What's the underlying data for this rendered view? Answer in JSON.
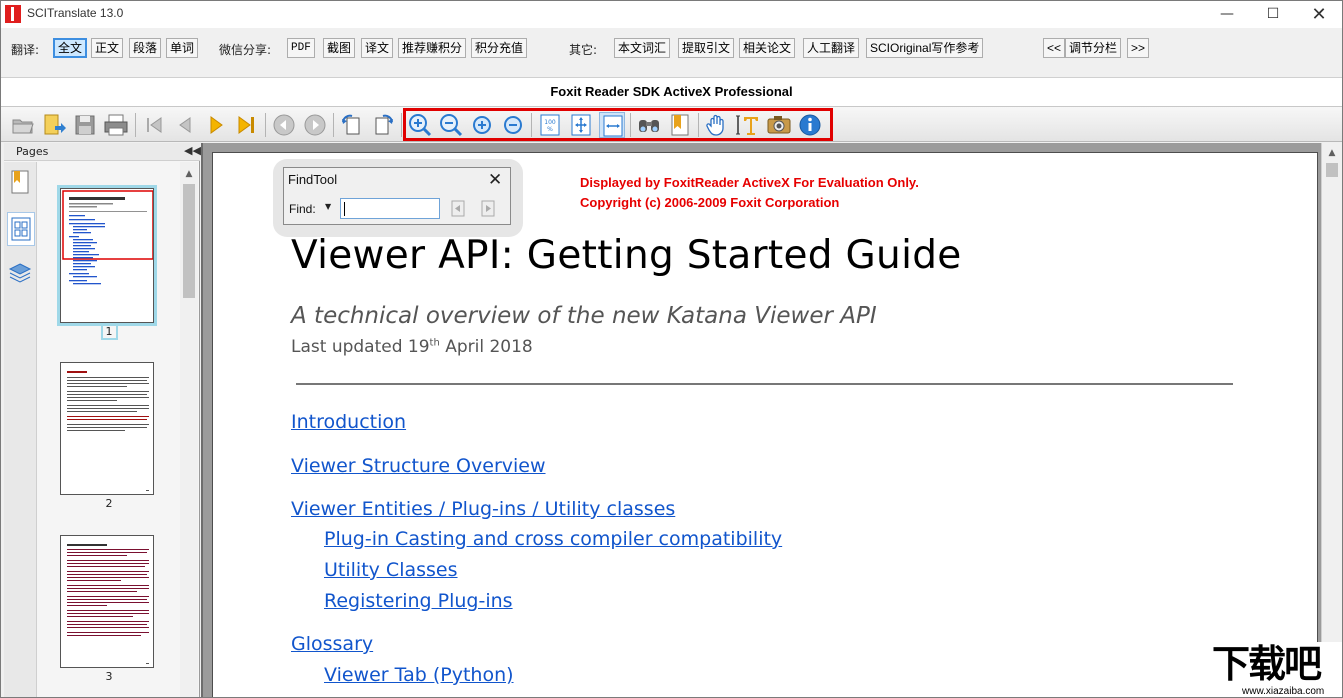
{
  "app": {
    "title": "SCITranslate 13.0"
  },
  "window": {
    "minimize": "—",
    "maximize": "☐",
    "close": "✕"
  },
  "cmdbar": {
    "translate_label": "翻译:",
    "translate_buttons": [
      "全文",
      "正文",
      "段落",
      "单词"
    ],
    "wechat_label": "微信分享:",
    "wechat_buttons": [
      "PDF",
      "截图",
      "译文",
      "推荐赚积分",
      "积分充值"
    ],
    "other_label": "其它:",
    "other_buttons": [
      "本文词汇",
      "提取引文",
      "相关论文",
      "人工翻译",
      "SCIOriginal写作参考"
    ],
    "split_prev": "<<",
    "split_label": "调节分栏",
    "split_next": ">>"
  },
  "viewer": {
    "title": "Foxit Reader SDK ActiveX Professional",
    "toolbar_icons": [
      "open-icon",
      "open-folder-icon",
      "save-icon",
      "print-icon",
      "first-page-icon",
      "prev-page-icon",
      "next-page-icon",
      "last-page-icon",
      "back-icon",
      "forward-icon",
      "rotate-left-icon",
      "rotate-right-icon",
      "zoom-in-icon",
      "zoom-out-icon",
      "zoom-plus-icon",
      "zoom-minus-icon",
      "actual-size-icon",
      "fit-page-icon",
      "fit-width-icon",
      "find-icon",
      "bookmark-icon",
      "hand-tool-icon",
      "text-select-icon",
      "snapshot-icon",
      "info-icon"
    ],
    "highlight_color": "#e00000"
  },
  "panel": {
    "title": "Pages",
    "collapse": "◀◀",
    "pages": [
      "1",
      "2",
      "3"
    ]
  },
  "findtool": {
    "title": "FindTool",
    "close": "✕",
    "label": "Find:",
    "value": ""
  },
  "document": {
    "eval_line1": "Displayed by FoxitReader ActiveX For Evaluation Only.",
    "eval_line2": "Copyright (c) 2006-2009 Foxit Corporation",
    "title": "Viewer API: Getting Started Guide",
    "subtitle": "A technical overview of the new Katana Viewer API",
    "updated_prefix": "Last updated 19",
    "updated_sup": "th",
    "updated_suffix": " April 2018",
    "toc": [
      "Introduction",
      "Viewer Structure Overview",
      "Viewer Entities / Plug-ins / Utility classes",
      "Plug-in Casting and cross compiler compatibility",
      "Utility Classes",
      "Registering Plug-ins",
      "Glossary",
      "Viewer Tab (Python)"
    ],
    "link_color": "#1155cc",
    "eval_color": "#e60000"
  },
  "watermark": {
    "main": "下载吧",
    "url": "www.xiazaiba.com"
  }
}
